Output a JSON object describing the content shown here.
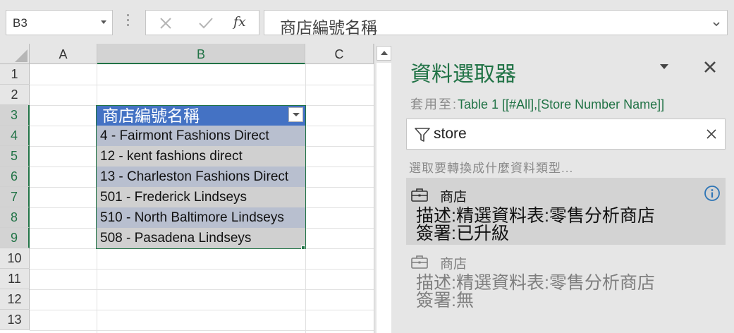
{
  "formula_bar": {
    "name_box": "B3",
    "fx_label": "fx",
    "formula": "商店編號名稱"
  },
  "grid": {
    "columns": [
      "A",
      "B",
      "C"
    ],
    "rows": [
      "1",
      "2",
      "3",
      "4",
      "5",
      "6",
      "7",
      "8",
      "9",
      "10",
      "11",
      "12",
      "13"
    ]
  },
  "table": {
    "header": "商店編號名稱",
    "rows": [
      "4 - Fairmont Fashions Direct",
      "12 - kent fashions direct",
      "13 - Charleston Fashions Direct",
      "501 - Frederick Lindseys",
      "510 - North Baltimore Lindseys",
      "508 - Pasadena Lindseys"
    ]
  },
  "pane": {
    "title": "資料選取器",
    "apply_label": "套用至:",
    "apply_target": "Table 1 [[#All],[Store Number Name]]",
    "search_value": "store",
    "hint": "選取要轉換成什麼資料類型...",
    "results": [
      {
        "name": "商店",
        "description": "描述:精選資料表:零售分析商店",
        "status": "簽署:已升級"
      },
      {
        "name": "商店",
        "description": "描述:精選資料表:零售分析商店",
        "status": "簽署:無"
      }
    ]
  },
  "colors": {
    "accent": "#217346",
    "table_header": "#4472c4",
    "info": "#2e75b6"
  }
}
